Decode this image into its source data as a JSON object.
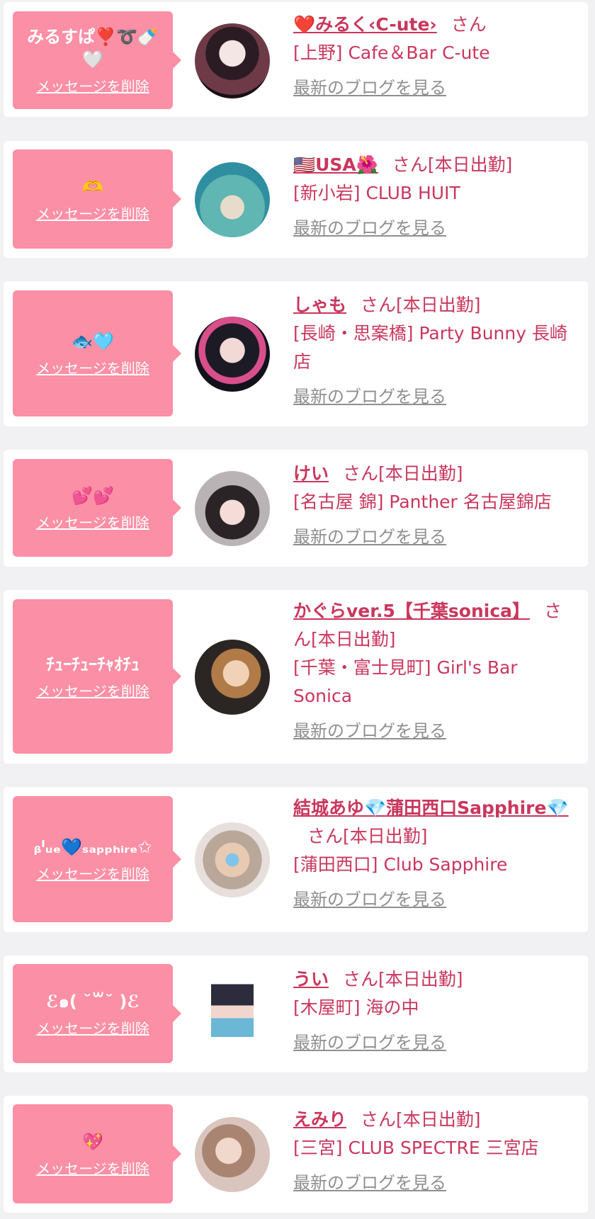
{
  "labels": {
    "delete_message": "メッセージを削除",
    "view_blog": "最新のブログを見る"
  },
  "colors": {
    "bubble": "#fb8fa5",
    "accent": "#c9375d",
    "link_gray": "#8f8f8f",
    "background": "#f1f1f3"
  },
  "entries": [
    {
      "message": "みるすぱ❣️➰🍼🤍",
      "name": "❤️みるく‹C-ute›",
      "suffix": "さん",
      "shop": "[上野] Cafe＆Bar C-ute"
    },
    {
      "message": "🫶",
      "name": "🇺🇸USA🌺",
      "suffix": "さん[本日出勤]",
      "shop": "[新小岩] CLUB HUIT"
    },
    {
      "message": "🐟🩵",
      "name": "しゃも",
      "suffix": "さん[本日出勤]",
      "shop": "[長崎・思案橋] Party Bunny 長崎店"
    },
    {
      "message": "💕💕",
      "name": "けい",
      "suffix": "さん[本日出勤]",
      "shop": "[名古屋 錦] Panther 名古屋錦店"
    },
    {
      "message": "ﾁｭｰﾁｭｰﾁｬｵﾁｭ",
      "name": "かぐらver.5【千葉sonica】",
      "suffix": "さん[本日出勤]",
      "shop": "[千葉・富士見町] Girl's Bar Sonica"
    },
    {
      "message": "ᵦˡᵤₑ💙ₛₐₚₚₕᵢᵣₑ✩",
      "name": "結城あゆ💎蒲田西口Sapphire💎",
      "suffix": "さん[本日出勤]",
      "shop": "[蒲田西口] Club Sapphire"
    },
    {
      "message": "ℰ๑( ˘꒳˘ )ℰ",
      "name": "うい",
      "suffix": "さん[本日出勤]",
      "shop": "[木屋町] 海の中"
    },
    {
      "message": "💖",
      "name": "えみり",
      "suffix": "さん[本日出勤]",
      "shop": "[三宮] CLUB SPECTRE 三宮店"
    }
  ]
}
